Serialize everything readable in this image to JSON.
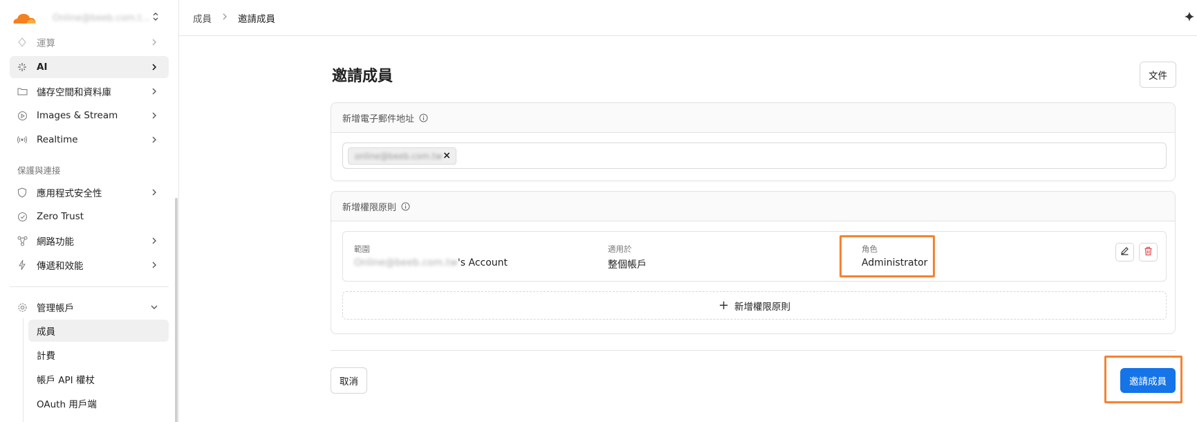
{
  "account": {
    "name": "Online@beeb.com.t...",
    "logo": "cloudflare-logo"
  },
  "sidebar": {
    "items_top": [
      {
        "label": "運算",
        "icon": "compute-icon"
      },
      {
        "label": "AI",
        "icon": "ai-sparkle-icon"
      },
      {
        "label": "儲存空間和資料庫",
        "icon": "folder-icon"
      },
      {
        "label": "Images & Stream",
        "icon": "play-icon"
      },
      {
        "label": "Realtime",
        "icon": "broadcast-icon"
      }
    ],
    "section_label": "保護與連接",
    "items_protect": [
      {
        "label": "應用程式安全性",
        "icon": "shield-icon"
      },
      {
        "label": "Zero Trust",
        "icon": "zero-trust-icon"
      },
      {
        "label": "網路功能",
        "icon": "network-icon"
      },
      {
        "label": "傳遞和效能",
        "icon": "bolt-icon"
      }
    ],
    "manage": {
      "label": "管理帳戶",
      "icon": "gear-icon"
    },
    "sub_items": [
      "成員",
      "計費",
      "帳戶 API 權杖",
      "OAuth 用戶端"
    ]
  },
  "breadcrumb": {
    "parent": "成員",
    "current": "邀請成員"
  },
  "page": {
    "title": "邀請成員",
    "docs_label": "文件"
  },
  "email_section": {
    "title": "新增電子郵件地址",
    "chip_value": "online@beeb.com.tw"
  },
  "policy_section": {
    "title": "新增權限原則",
    "scope_label": "範圍",
    "scope_value_blurred": "Online@beeb.com.tw",
    "scope_value_suffix": "'s Account",
    "applies_label": "適用於",
    "applies_value": "整個帳戶",
    "role_label": "角色",
    "role_value": "Administrator",
    "add_label": "新增權限原則"
  },
  "footer": {
    "cancel_label": "取消",
    "invite_label": "邀請成員"
  },
  "colors": {
    "accent": "#1474e8",
    "highlight": "#f58232",
    "danger": "#e5484d",
    "logo_orange": "#f48120"
  }
}
